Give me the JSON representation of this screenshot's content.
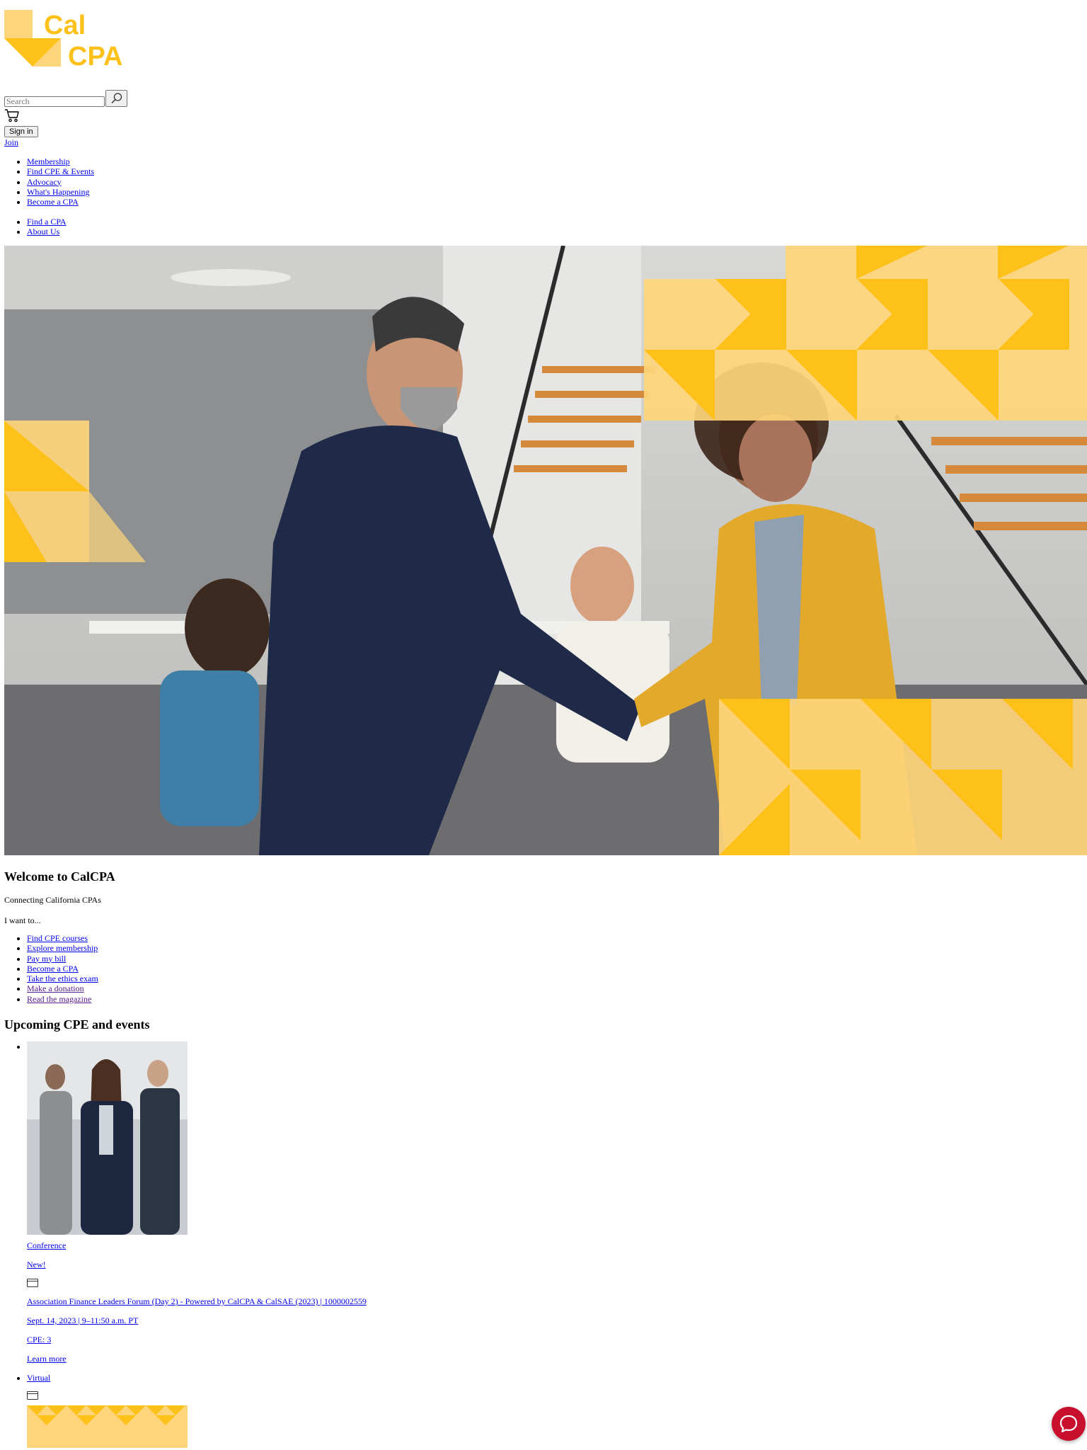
{
  "header": {
    "logo_text_line1": "Cal",
    "logo_text_line2": "CPA",
    "search_placeholder": "Search",
    "sign_in_label": "Sign in",
    "join_label": "Join"
  },
  "nav": {
    "main": [
      "Membership",
      "Find CPE & Events",
      "Advocacy",
      "What's Happening",
      "Become a CPA"
    ],
    "secondary": [
      "Find a CPA",
      "About Us"
    ]
  },
  "welcome": {
    "title": "Welcome to CalCPA",
    "tagline": "Connecting California CPAs",
    "prompt": "I want to...",
    "links": [
      "Find CPE courses",
      "Explore membership",
      "Pay my bill",
      "Become a CPA",
      "Take the ethics exam",
      "Make a donation",
      "Read the magazine"
    ]
  },
  "events": {
    "title": "Upcoming CPE and events",
    "items": [
      {
        "type": "Conference",
        "badge": "New!",
        "name": "Association Finance Leaders Forum (Day 2) - Powered by CalCPA & CalSAE (2023) | 1000002559",
        "date": "Sept. 14, 2023 | 9–11:50 a.m. PT",
        "cpe": "CPE: 3",
        "cta": "Learn more"
      },
      {
        "type": "Virtual"
      }
    ]
  },
  "colors": {
    "brand_yellow": "#FDC11A",
    "brand_yellow_light": "#FED57A",
    "chat_red": "#C8102E"
  },
  "icons": [
    "search-icon",
    "cart-icon",
    "card-icon",
    "chat-icon"
  ]
}
